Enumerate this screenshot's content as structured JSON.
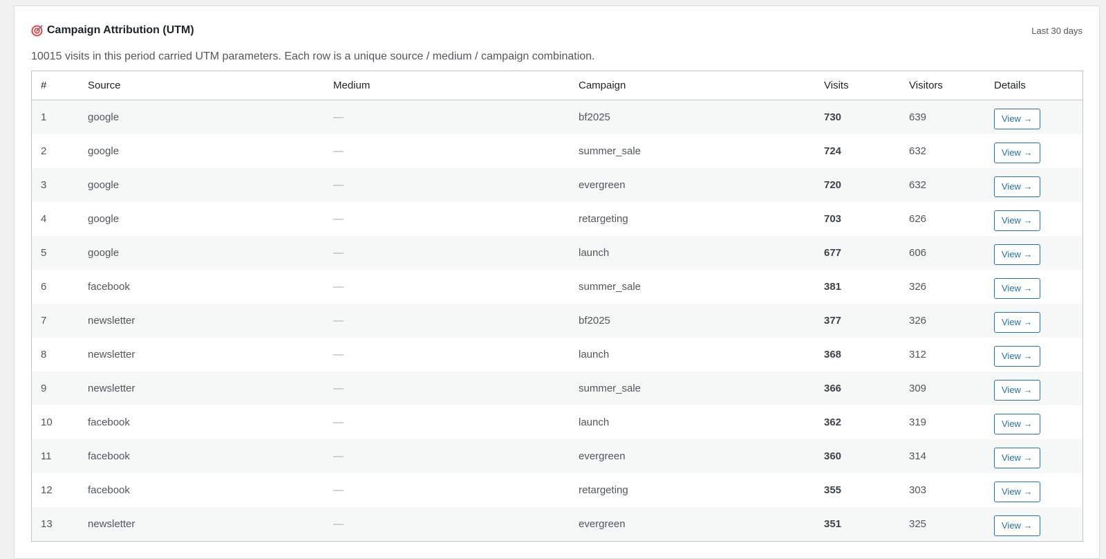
{
  "header": {
    "icon": "target-icon",
    "title": "Campaign Attribution (UTM)",
    "period": "Last 30 days"
  },
  "description": "10015 visits in this period carried UTM parameters. Each row is a unique source / medium / campaign combination.",
  "colors": {
    "accent": "#2271b1",
    "stripe": "#f6f7f7",
    "border": "#c3c4c7"
  },
  "table": {
    "columns": [
      "#",
      "Source",
      "Medium",
      "Campaign",
      "Visits",
      "Visitors",
      "Details"
    ],
    "rows": [
      {
        "rank": "1",
        "source": "google",
        "medium": "—",
        "campaign": "bf2025",
        "visits": "730",
        "visitors": "639",
        "details": "View →"
      },
      {
        "rank": "2",
        "source": "google",
        "medium": "—",
        "campaign": "summer_sale",
        "visits": "724",
        "visitors": "632",
        "details": "View →"
      },
      {
        "rank": "3",
        "source": "google",
        "medium": "—",
        "campaign": "evergreen",
        "visits": "720",
        "visitors": "632",
        "details": "View →"
      },
      {
        "rank": "4",
        "source": "google",
        "medium": "—",
        "campaign": "retargeting",
        "visits": "703",
        "visitors": "626",
        "details": "View →"
      },
      {
        "rank": "5",
        "source": "google",
        "medium": "—",
        "campaign": "launch",
        "visits": "677",
        "visitors": "606",
        "details": "View →"
      },
      {
        "rank": "6",
        "source": "facebook",
        "medium": "—",
        "campaign": "summer_sale",
        "visits": "381",
        "visitors": "326",
        "details": "View →"
      },
      {
        "rank": "7",
        "source": "newsletter",
        "medium": "—",
        "campaign": "bf2025",
        "visits": "377",
        "visitors": "326",
        "details": "View →"
      },
      {
        "rank": "8",
        "source": "newsletter",
        "medium": "—",
        "campaign": "launch",
        "visits": "368",
        "visitors": "312",
        "details": "View →"
      },
      {
        "rank": "9",
        "source": "newsletter",
        "medium": "—",
        "campaign": "summer_sale",
        "visits": "366",
        "visitors": "309",
        "details": "View →"
      },
      {
        "rank": "10",
        "source": "facebook",
        "medium": "—",
        "campaign": "launch",
        "visits": "362",
        "visitors": "319",
        "details": "View →"
      },
      {
        "rank": "11",
        "source": "facebook",
        "medium": "—",
        "campaign": "evergreen",
        "visits": "360",
        "visitors": "314",
        "details": "View →"
      },
      {
        "rank": "12",
        "source": "facebook",
        "medium": "—",
        "campaign": "retargeting",
        "visits": "355",
        "visitors": "303",
        "details": "View →"
      },
      {
        "rank": "13",
        "source": "newsletter",
        "medium": "—",
        "campaign": "evergreen",
        "visits": "351",
        "visitors": "325",
        "details": "View →"
      }
    ]
  }
}
